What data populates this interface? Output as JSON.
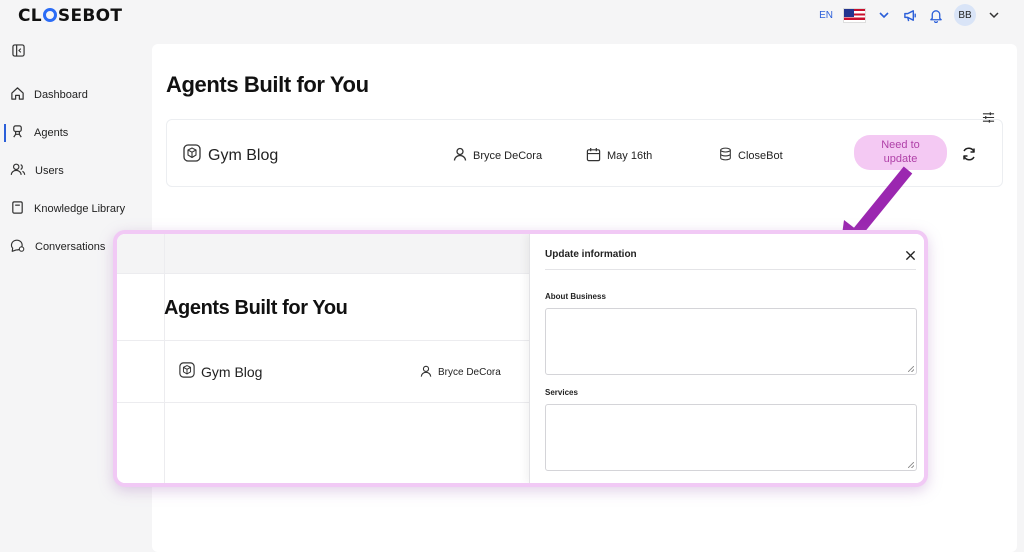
{
  "brand": {
    "logo_pre": "CL",
    "logo_post": "SEBOT"
  },
  "header": {
    "language": "EN",
    "avatar_initials": "BB"
  },
  "sidebar": {
    "items": [
      {
        "label": "Dashboard",
        "icon": "home-icon"
      },
      {
        "label": "Agents",
        "icon": "agent-icon",
        "active": true
      },
      {
        "label": "Users",
        "icon": "users-icon"
      },
      {
        "label": "Knowledge Library",
        "icon": "book-icon"
      },
      {
        "label": "Conversations",
        "icon": "chat-icon"
      }
    ]
  },
  "main": {
    "title": "Agents Built for You",
    "agent": {
      "name": "Gym Blog",
      "owner": "Bryce DeCora",
      "date": "May 16th",
      "source": "CloseBot",
      "status_line1": "Need to",
      "status_line2": "update"
    }
  },
  "callout": {
    "title": "Agents Built for You",
    "agent_name": "Gym Blog",
    "owner": "Bryce DeCora",
    "panel": {
      "title": "Update information",
      "about_label": "About Business",
      "services_label": "Services"
    }
  },
  "colors": {
    "accent": "#2b5fd9",
    "badge_bg": "#f4c9f3",
    "badge_text": "#b041a8",
    "arrow": "#9b27b0"
  }
}
